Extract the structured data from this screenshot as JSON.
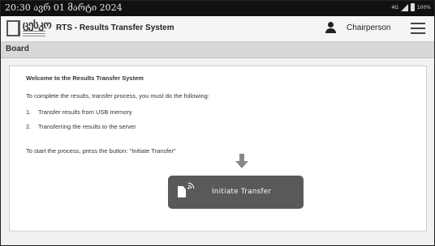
{
  "status_bar": {
    "time": "20:30 ავრ 01 მარტი 2024",
    "signal_label": "4G",
    "battery_label": "100%"
  },
  "app_bar": {
    "logo_mark": "ცესკო",
    "title": "RTS - Results Transfer System",
    "user_role": "Chairperson",
    "icons": {
      "user": "user-icon",
      "menu": "hamburger-menu-icon"
    }
  },
  "board": {
    "label": "Board"
  },
  "panel": {
    "welcome": "Welcome to the Results Transfer System",
    "intro": "To complete the results, transfer process, you must do the following:",
    "steps": [
      {
        "num": "1.",
        "text": "Transfer results from USB memory"
      },
      {
        "num": "2.",
        "text": "Transferring the results to the server"
      }
    ],
    "start_text": "To start the process, press the button: \"Initiate Transfer\"",
    "button_label": "Initiate Transfer"
  },
  "colors": {
    "status_bar_bg": "#111111",
    "button_bg": "#595959",
    "arrow": "#888888"
  }
}
